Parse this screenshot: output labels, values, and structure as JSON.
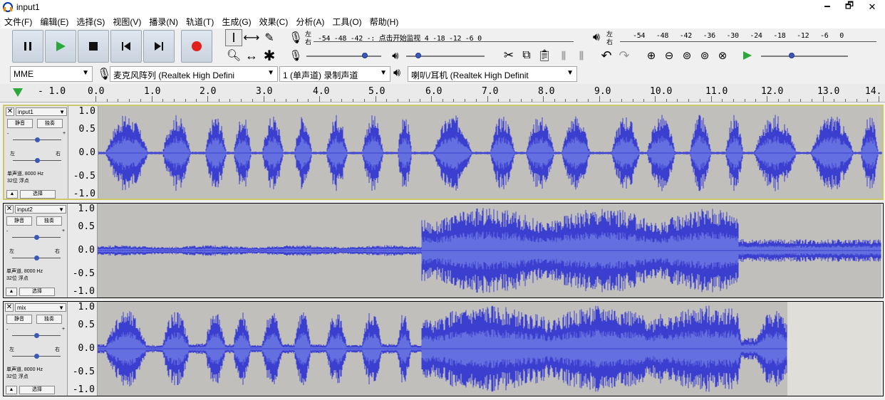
{
  "window": {
    "title": "input1",
    "minimize": "🗕",
    "maximize": "🗗",
    "close": "✕"
  },
  "menu": [
    "文件(F)",
    "编辑(E)",
    "选择(S)",
    "视图(V)",
    "播录(N)",
    "轨道(T)",
    "生成(G)",
    "效果(C)",
    "分析(A)",
    "工具(O)",
    "帮助(H)"
  ],
  "meters": {
    "record_scale": "-54 -48 -42 -: 点击开始监视 4 -18 -12 -6 0",
    "play_scale": "-54 -48 -42 -36 -30 -24 -18 -12 -6 0",
    "lr_left": "左",
    "lr_right": "右",
    "record_level": 0.78,
    "playback_level": 0.15,
    "play_speed": 0.35
  },
  "devices": {
    "host": "MME",
    "mic": "麦克风阵列 (Realtek High Defini",
    "channels": "1 (单声道) 录制声道",
    "speaker": "喇叭/耳机 (Realtek High Definit"
  },
  "ruler": {
    "labels": [
      "- 1.0",
      "0.0",
      "1.0",
      "2.0",
      "3.0",
      "4.0",
      "5.0",
      "6.0",
      "7.0",
      "8.0",
      "9.0",
      "10.0",
      "11.0",
      "12.0",
      "13.0",
      "14."
    ]
  },
  "tracks": [
    {
      "name": "input1",
      "mute": "静音",
      "solo": "独奏",
      "l": "左",
      "r": "右",
      "info1": "单声道, 8000 Hz",
      "info2": "32位 浮点",
      "select": "选择",
      "vaxis": [
        "1.0",
        "0.5",
        "0.0",
        "-0.5",
        "-1.0"
      ],
      "gain": 0.5,
      "pan": 0.5,
      "end_fraction": 1.0
    },
    {
      "name": "input2",
      "mute": "静音",
      "solo": "独奏",
      "l": "左",
      "r": "右",
      "info1": "单声道, 8000 Hz",
      "info2": "32位 浮点",
      "select": "选择",
      "vaxis": [
        "1.0",
        "0.5",
        "0.0",
        "-0.5",
        "-1.0"
      ],
      "gain": 0.5,
      "pan": 0.5,
      "end_fraction": 1.0
    },
    {
      "name": "mix",
      "mute": "静音",
      "solo": "独奏",
      "l": "左",
      "r": "右",
      "info1": "单声道, 8000 Hz",
      "info2": "32位 浮点",
      "select": "选择",
      "vaxis": [
        "1.0",
        "0.5",
        "0.0",
        "-0.5",
        "-1.0"
      ],
      "gain": 0.5,
      "pan": 0.5,
      "end_fraction": 0.88
    }
  ],
  "colors": {
    "wave": "#3b3fcf",
    "wave_rms": "#6470e0",
    "wave_bg": "#c0bfbc",
    "selected_border": "#ccc86a",
    "record": "#e1211c",
    "play": "#2aa83b"
  }
}
